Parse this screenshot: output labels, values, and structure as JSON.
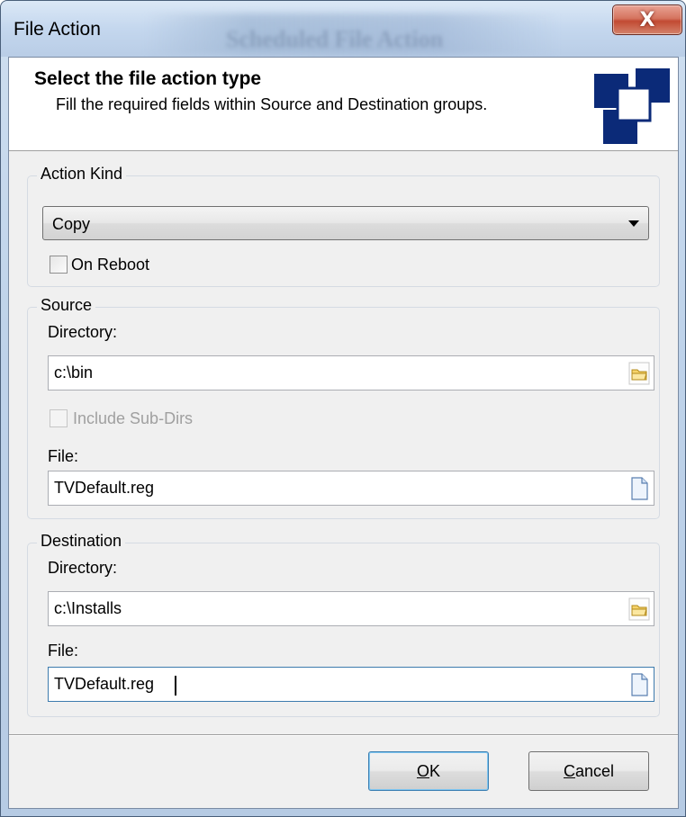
{
  "window": {
    "title": "File Action",
    "background_title": "Scheduled File Action",
    "close_glyph": "X"
  },
  "header": {
    "title": "Select the file action type",
    "subtitle": "Fill the required fields within Source and Destination groups.",
    "logo_icon": "blue-squares-logo",
    "logo_color": "#0b2a78"
  },
  "action_kind": {
    "group_label": "Action Kind",
    "selected": "Copy",
    "on_reboot_label": "On Reboot",
    "on_reboot_checked": false
  },
  "source": {
    "group_label": "Source",
    "directory_label": "Directory:",
    "directory_value": "c:\\bin",
    "include_subdirs_label": "Include Sub-Dirs",
    "include_subdirs_checked": false,
    "include_subdirs_enabled": false,
    "file_label": "File:",
    "file_value": "TVDefault.reg"
  },
  "destination": {
    "group_label": "Destination",
    "directory_label": "Directory:",
    "directory_value": "c:\\Installs",
    "file_label": "File:",
    "file_value": "TVDefault.reg"
  },
  "buttons": {
    "ok_mnemonic": "O",
    "ok_rest": "K",
    "cancel_mnemonic": "C",
    "cancel_rest": "ancel"
  },
  "icons": {
    "folder": "folder-open-icon",
    "file": "document-icon",
    "dropdown": "chevron-down-icon"
  }
}
